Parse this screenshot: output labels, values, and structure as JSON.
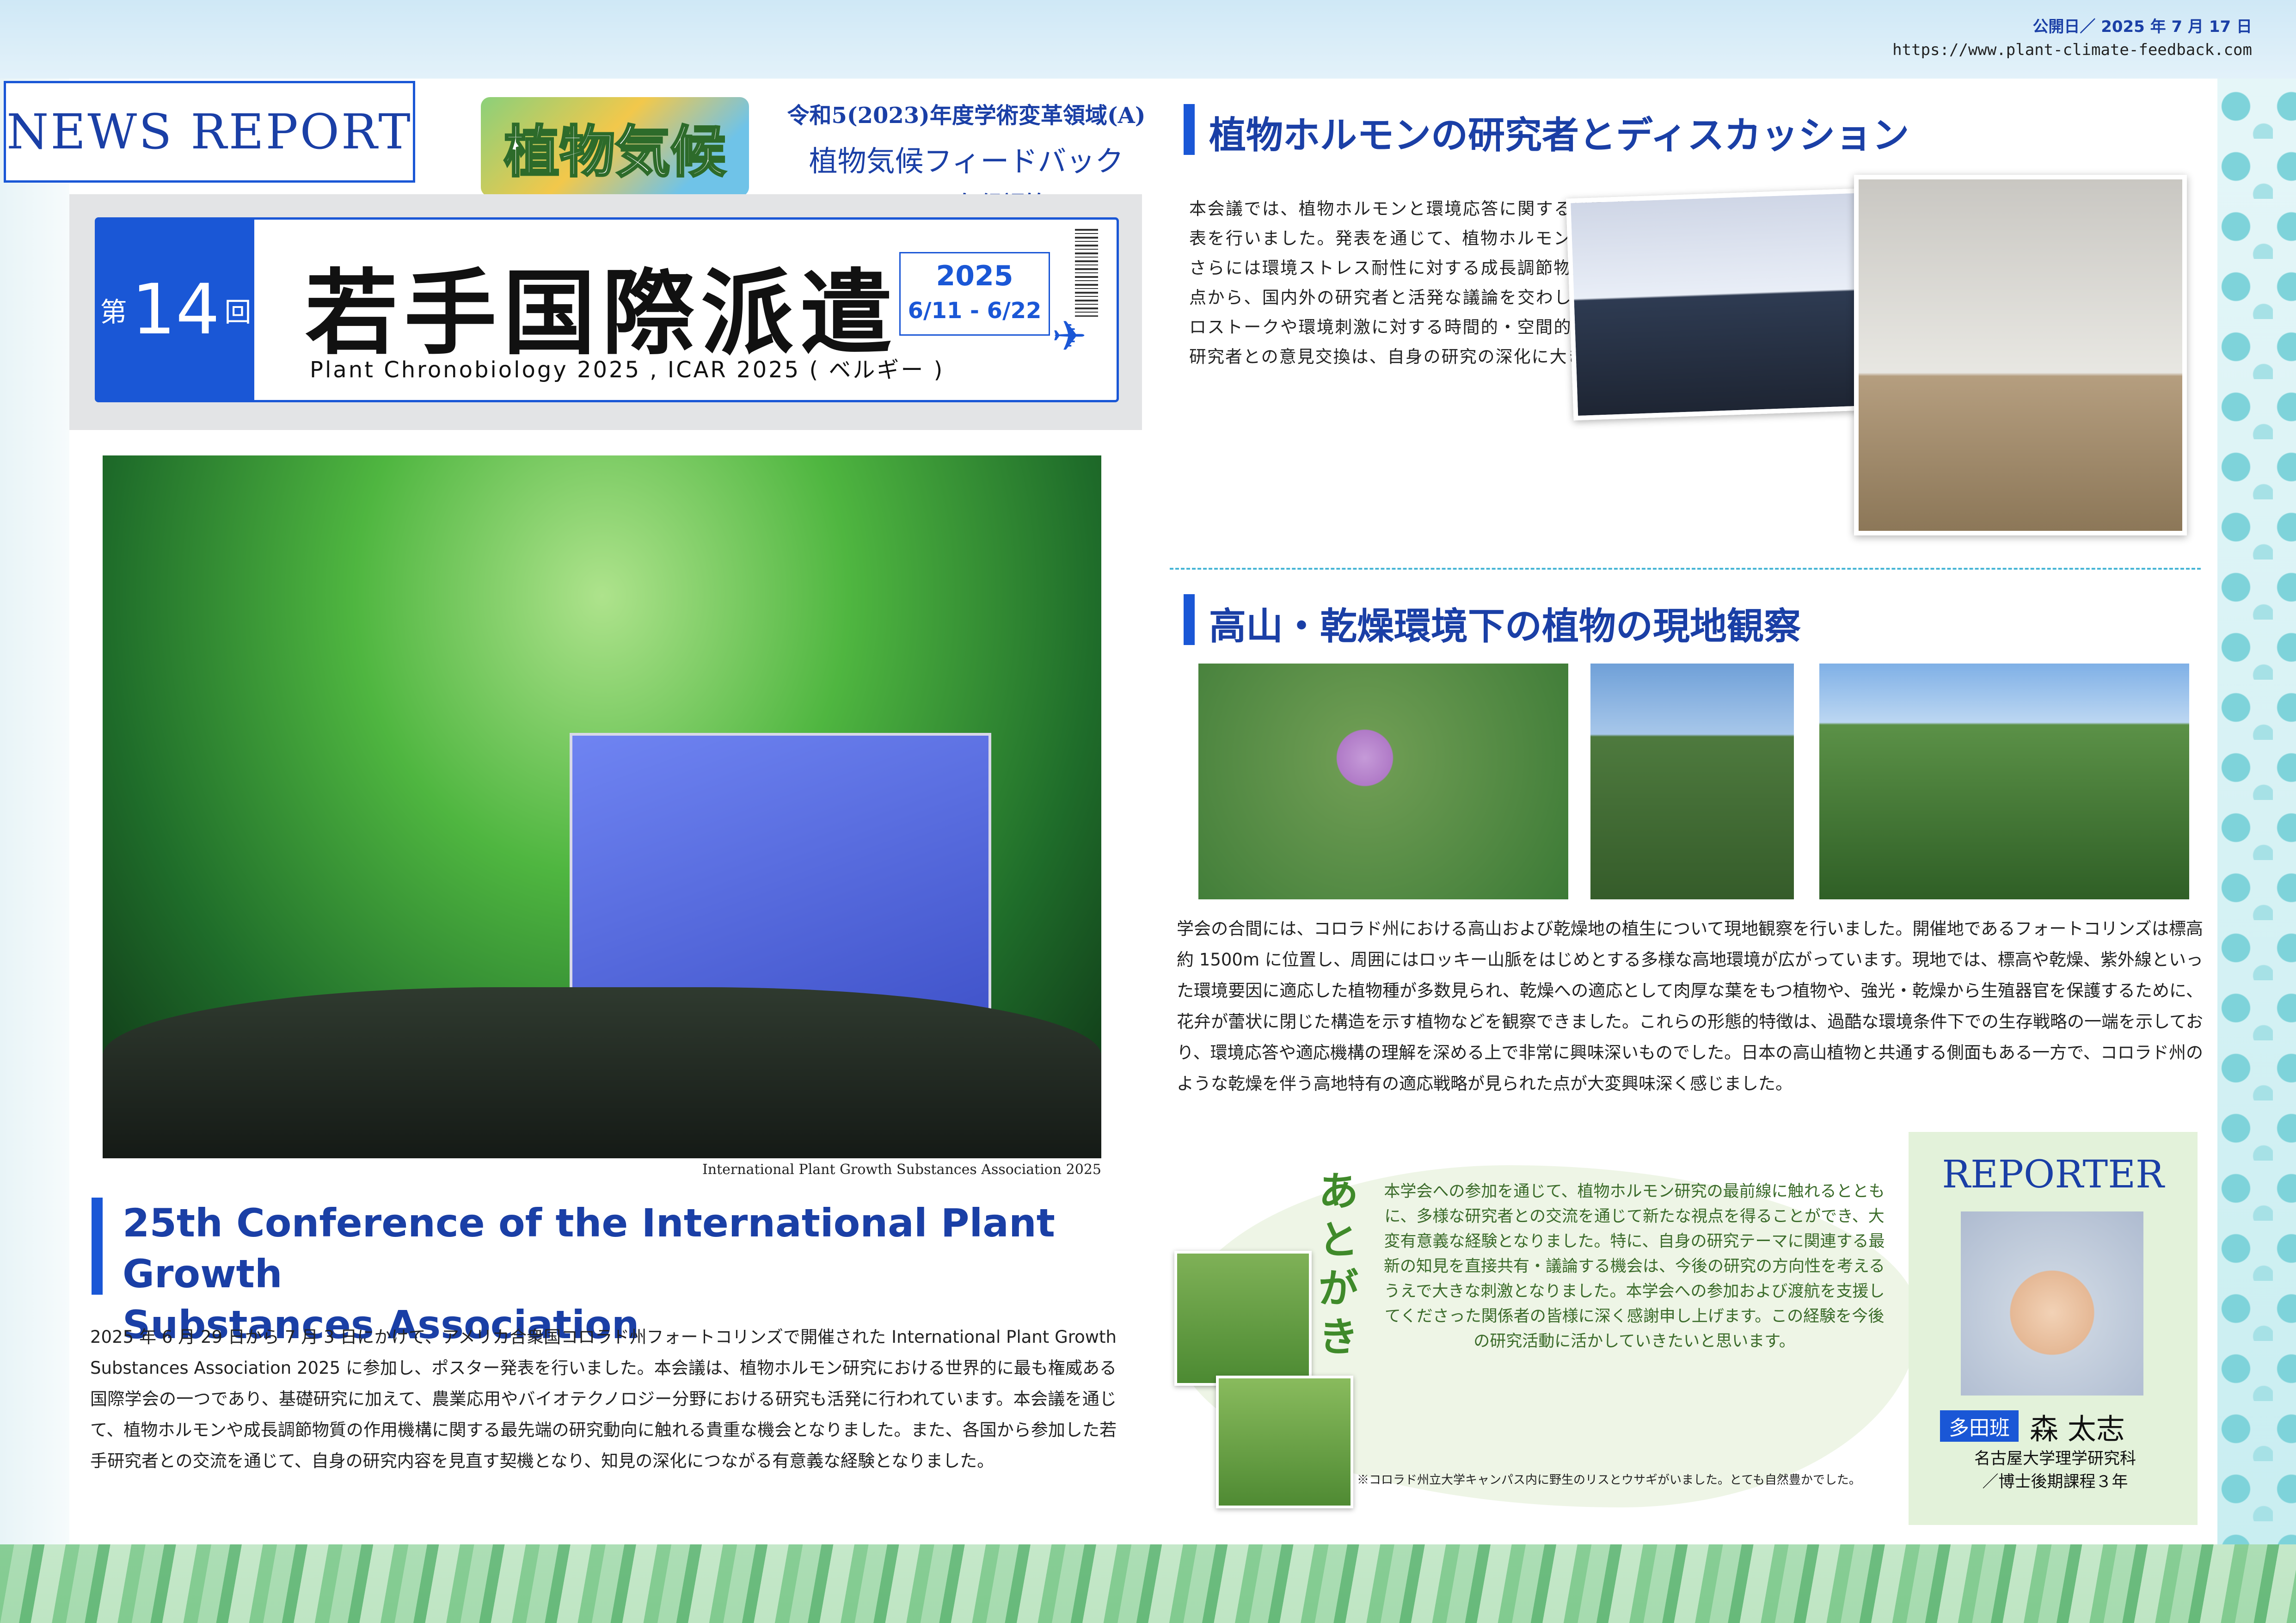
{
  "header": {
    "pub_date": "公開日／ 2025 年 7 月 17 日",
    "url": "https://www.plant-climate-feedback.com",
    "news_report": "NEWS REPORT",
    "logo_text": "植物気候",
    "grant_line1": "令和5(2023)年度学術変革領域(A)",
    "grant_line2": "植物気候フィードバック",
    "grant_line3": "BVOC気候調節"
  },
  "ticket": {
    "issue_prefix": "第",
    "issue_number": "14",
    "issue_suffix": "回",
    "title": "若手国際派遣",
    "year": "2025",
    "dates": "6/11 - 6/22",
    "events": "Plant Chronobiology 2025 , ICAR 2025 ( ベルギー )"
  },
  "conference": {
    "photo_caption": "International Plant Growth Substances Association 2025",
    "title_line1": "25th Conference of the International Plant Growth",
    "title_line2": "Substances Association",
    "body": "2025 年 6 月 29 日から 7 月 3 日にかけて、アメリカ合衆国コロラド州フォートコリンズで開催された International Plant Growth Substances Association 2025 に参加し、ポスター発表を行いました。本会議は、植物ホルモン研究における世界的に最も権威ある国際学会の一つであり、基礎研究に加えて、農業応用やバイオテクノロジー分野における研究も活発に行われています。本会議を通じて、植物ホルモンや成長調節物質の作用機構に関する最先端の研究動向に触れる貴重な機会となりました。また、各国から参加した若手研究者との交流を通じて、自身の研究内容を見直す契機となり、知見の深化につながる有意義な経験となりました。"
  },
  "hormone": {
    "heading": "植物ホルモンの研究者とディスカッション",
    "body": "本会議では、植物ホルモンと環境応答に関する研究成果についてポスター発表を行いました。発表を通じて、植物ホルモン応答と形態形成との関係性、さらには環境ストレス耐性に対する成長調節物質の作用といった多角的な視点から、国内外の研究者と活発な議論を交わしました。特に、ホルモン間クロストークや環境刺激に対する時間的・空間的な応答制御機構に関心を持つ研究者との意見交換は、自身の研究の深化に大きく寄与するものでした。"
  },
  "alpine": {
    "heading": "高山・乾燥環境下の植物の現地観察",
    "body": "学会の合間には、コロラド州における高山および乾燥地の植生について現地観察を行いました。開催地であるフォートコリンズは標高約 1500m に位置し、周囲にはロッキー山脈をはじめとする多様な高地環境が広がっています。現地では、標高や乾燥、紫外線といった環境要因に適応した植物種が多数見られ、乾燥への適応として肉厚な葉をもつ植物や、強光・乾燥から生殖器官を保護するために、花弁が蕾状に閉じた構造を示す植物などを観察できました。これらの形態的特徴は、過酷な環境条件下での生存戦略の一端を示しており、環境応答や適応機構の理解を深める上で非常に興味深いものでした。日本の高山植物と共通する側面もある一方で、コロラド州のような乾燥を伴う高地特有の適応戦略が見られた点が大変興味深く感じました。"
  },
  "atogaki": {
    "heading": "あとがき",
    "body": "本学会への参加を通じて、植物ホルモン研究の最前線に触れるとともに、多様な研究者との交流を通じて新たな視点を得ることができ、大変有意義な経験となりました。特に、自身の研究テーマに関連する最新の知見を直接共有・議論する機会は、今後の研究の方向性を考えるうえで大きな刺激となりました。本学会への参加および渡航を支援してくださった関係者の皆様に深く感謝申し上げます。この経験を今後の研究活動に活かしていきたいと思います。",
    "note": "※コロラド州立大学キャンパス内に野生のリスとウサギがいました。とても自然豊かでした。"
  },
  "reporter": {
    "heading": "REPORTER",
    "group": "多田班",
    "name": "森 太志",
    "affiliation_line1": "名古屋大学理学研究科",
    "affiliation_line2": "／博士後期課程３年"
  },
  "colors": {
    "accent_blue": "#1a57d6",
    "title_blue": "#1a3fa6",
    "atogaki_green": "#3f8a2a"
  }
}
